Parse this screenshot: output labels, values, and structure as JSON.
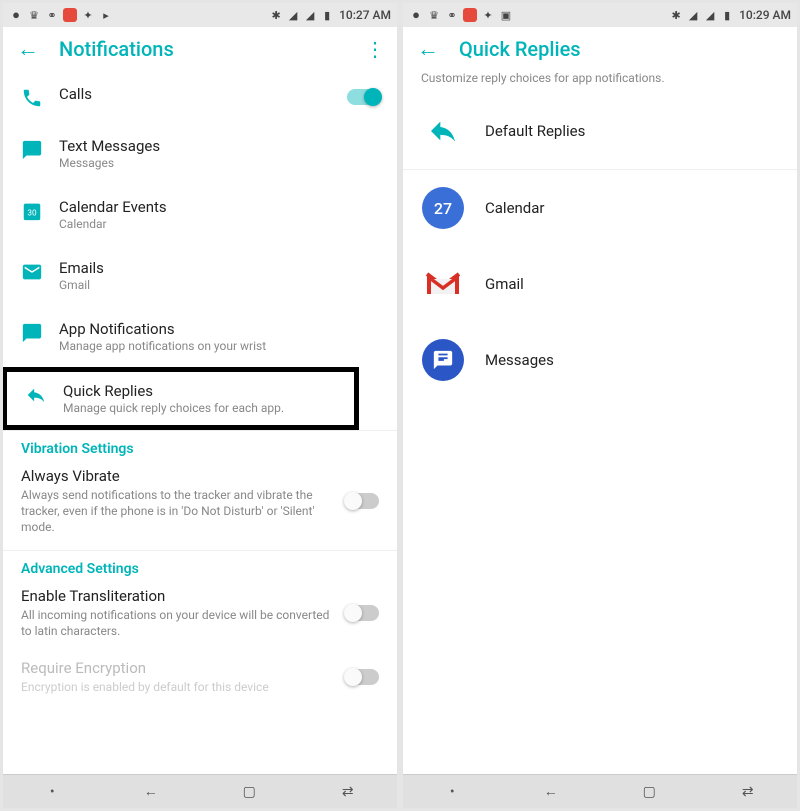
{
  "left": {
    "status_time": "10:27 AM",
    "header_title": "Notifications",
    "items": {
      "calls": {
        "title": "Calls"
      },
      "text": {
        "title": "Text Messages",
        "sub": "Messages"
      },
      "calendar": {
        "title": "Calendar Events",
        "sub": "Calendar",
        "day": "30"
      },
      "emails": {
        "title": "Emails",
        "sub": "Gmail"
      },
      "appnotif": {
        "title": "App Notifications",
        "sub": "Manage app notifications on your wrist"
      },
      "quick": {
        "title": "Quick Replies",
        "sub": "Manage quick reply choices for each app."
      }
    },
    "vibration": {
      "header": "Vibration Settings",
      "always_title": "Always Vibrate",
      "always_sub": "Always send notifications to the tracker and vibrate the tracker, even if the phone is in 'Do Not Disturb' or 'Silent' mode."
    },
    "advanced": {
      "header": "Advanced Settings",
      "translit_title": "Enable Transliteration",
      "translit_sub": "All incoming notifications on your device will be converted to latin characters.",
      "encrypt_title": "Require Encryption",
      "encrypt_sub": "Encryption is enabled by default for this device"
    }
  },
  "right": {
    "status_time": "10:29 AM",
    "header_title": "Quick Replies",
    "subtitle": "Customize reply choices for app notifications.",
    "items": {
      "default": "Default Replies",
      "calendar": "Calendar",
      "calendar_day": "27",
      "gmail": "Gmail",
      "messages": "Messages"
    }
  }
}
